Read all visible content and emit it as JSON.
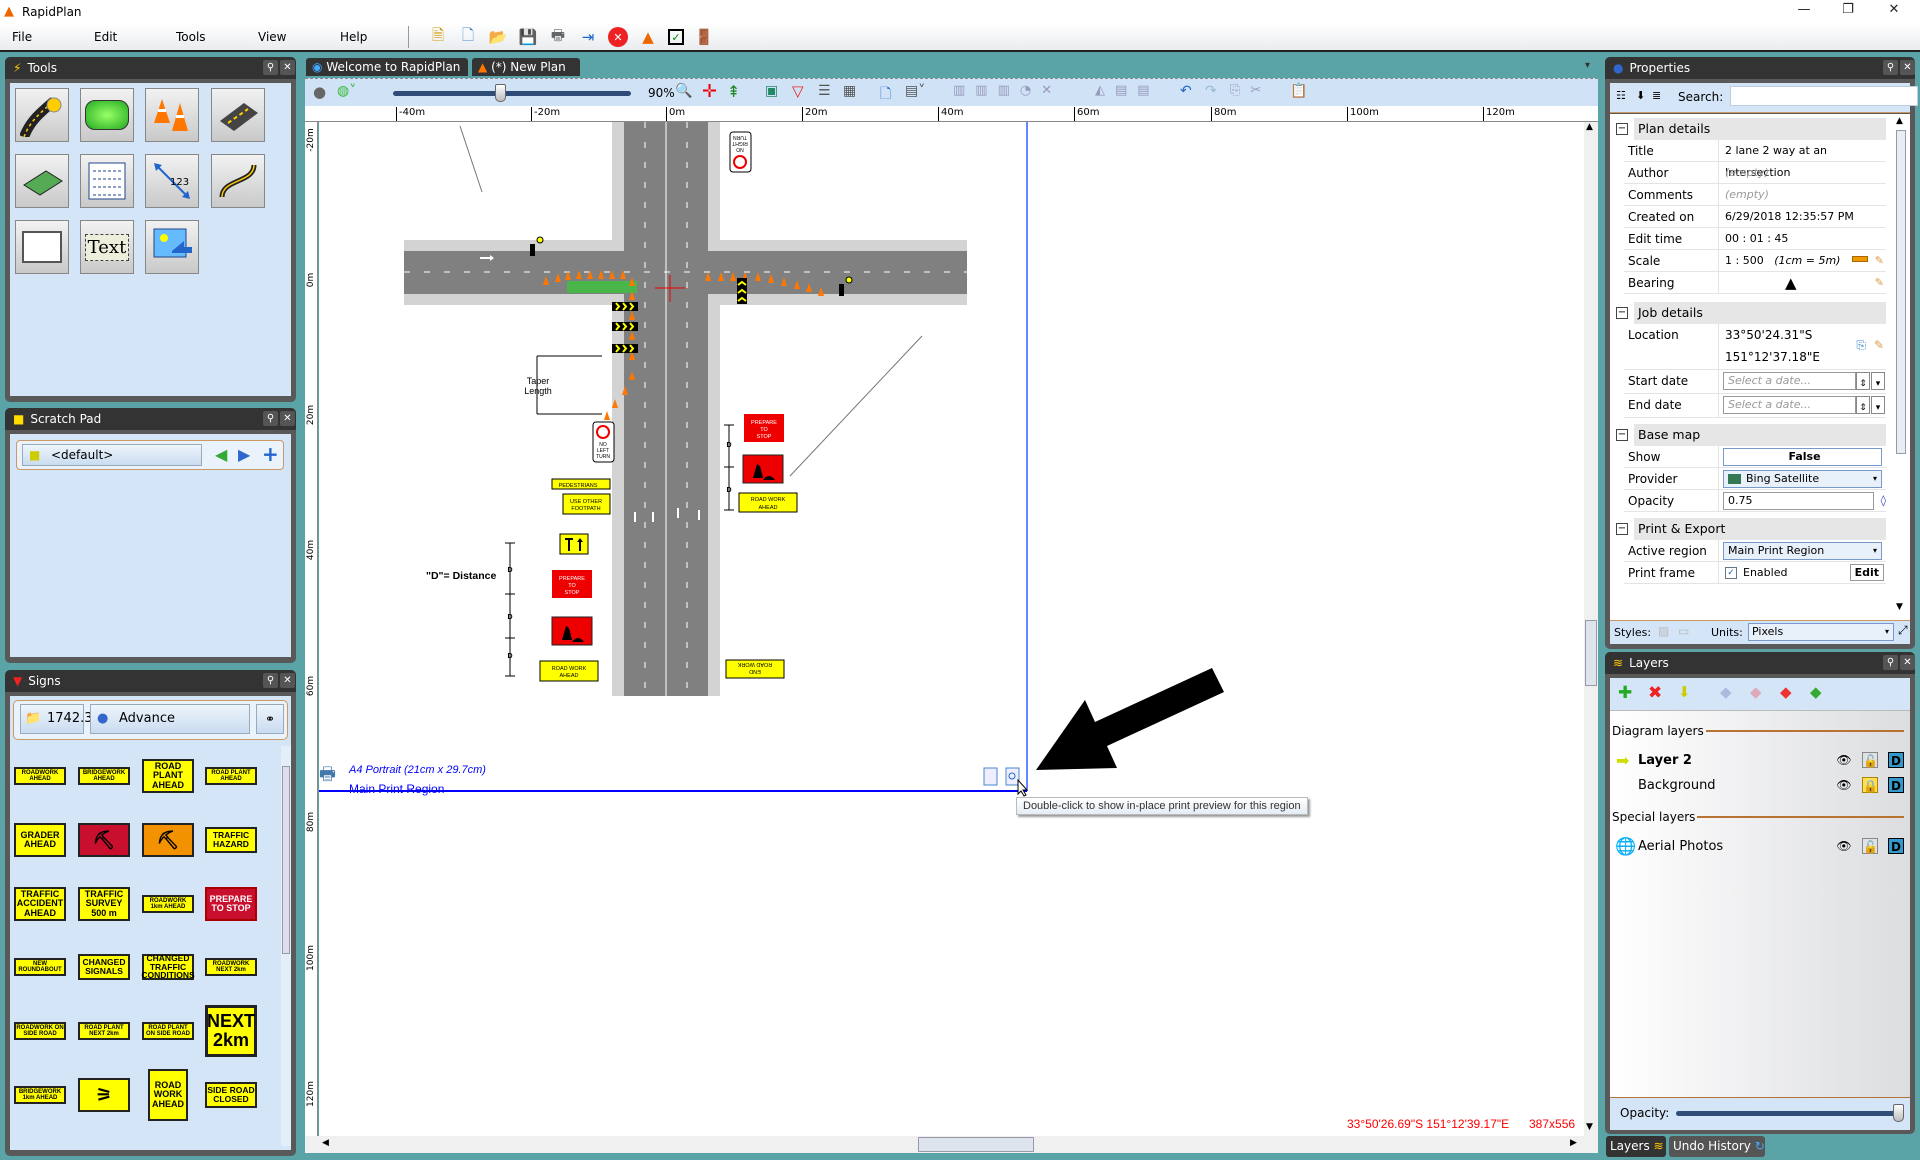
{
  "app": {
    "title": "RapidPlan",
    "menu": [
      "File",
      "Edit",
      "Tools",
      "View",
      "Help"
    ],
    "toolbar_icons": [
      "new-plan-wizard-icon",
      "new-document-icon",
      "open-folder-icon",
      "save-icon",
      "print-icon",
      "export-icon",
      "close-red-icon",
      "rapidplan-cone-icon",
      "checklist-icon",
      "exit-door-icon"
    ]
  },
  "tools_panel": {
    "title": "Tools",
    "tools": [
      "road-tool",
      "barrier-tool",
      "cones-tool",
      "road-segment-tool",
      "area-pattern-tool",
      "grid-tool",
      "measure-tool",
      "path-tool",
      "rectangle-tool",
      "text-tool",
      "image-tool"
    ],
    "text_tile": "Text",
    "measure_label": "123"
  },
  "scratch_pad": {
    "title": "Scratch Pad",
    "selected": "<default>"
  },
  "signs_panel": {
    "title": "Signs",
    "category_code": "1742.3",
    "category": "Advance",
    "signs": [
      {
        "text": "ROADWORK AHEAD",
        "bg": "#ffff00",
        "size": "small"
      },
      {
        "text": "BRIDGEWORK AHEAD",
        "bg": "#ffff00",
        "size": "small"
      },
      {
        "text": "ROAD PLANT AHEAD",
        "bg": "#ffff00",
        "size": "large"
      },
      {
        "text": "ROAD PLANT AHEAD",
        "bg": "#ffff00",
        "size": "small"
      },
      {
        "text": "GRADER AHEAD",
        "bg": "#ffff00",
        "size": "large"
      },
      {
        "text": "",
        "bg": "#c8102e",
        "size": "worker"
      },
      {
        "text": "",
        "bg": "#f39200",
        "size": "worker"
      },
      {
        "text": "TRAFFIC HAZARD",
        "bg": "#ffff00",
        "size": "medium"
      },
      {
        "text": "TRAFFIC ACCIDENT AHEAD",
        "bg": "#ffff00",
        "size": "large"
      },
      {
        "text": "TRAFFIC SURVEY 500 m",
        "bg": "#ffff00",
        "size": "large"
      },
      {
        "text": "ROADWORK 1km AHEAD",
        "bg": "#ffff00",
        "size": "small"
      },
      {
        "text": "PREPARE TO STOP",
        "bg": "#c8102e",
        "size": "red"
      },
      {
        "text": "NEW ROUNDABOUT",
        "bg": "#ffff00",
        "size": "small"
      },
      {
        "text": "CHANGED SIGNALS",
        "bg": "#ffff00",
        "size": "medium"
      },
      {
        "text": "CHANGED TRAFFIC CONDITIONS",
        "bg": "#ffff00",
        "size": "medium"
      },
      {
        "text": "ROADWORK NEXT 2km",
        "bg": "#ffff00",
        "size": "small"
      },
      {
        "text": "ROADWORK ON SIDE ROAD",
        "bg": "#ffff00",
        "size": "small"
      },
      {
        "text": "ROAD PLANT NEXT 2km",
        "bg": "#ffff00",
        "size": "small"
      },
      {
        "text": "ROAD PLANT ON SIDE ROAD",
        "bg": "#ffff00",
        "size": "small"
      },
      {
        "text": "NEXT 2km",
        "bg": "#ffff00",
        "size": "xl"
      },
      {
        "text": "BRIDGEWORK 1km AHEAD",
        "bg": "#ffff00",
        "size": "small"
      },
      {
        "text": "",
        "bg": "#ffff00",
        "size": "signal"
      },
      {
        "text": "ROAD WORK AHEAD",
        "bg": "#ffff00",
        "size": "tall"
      },
      {
        "text": "SIDE ROAD CLOSED",
        "bg": "#ffff00",
        "size": "medium"
      }
    ]
  },
  "document": {
    "tabs": [
      {
        "label": "Welcome to RapidPlan",
        "icon": "rapidplan-globe-icon"
      },
      {
        "label": "(*) New Plan",
        "icon": "cone-icon"
      }
    ],
    "zoom": "90%",
    "zoom_fraction": 0.45,
    "ruler_x": [
      "-40m",
      "-20m",
      "0m",
      "20m",
      "40m",
      "60m",
      "80m",
      "100m",
      "120m"
    ],
    "ruler_y": [
      "-20m",
      "0m",
      "20m",
      "40m",
      "60m",
      "80m",
      "100m",
      "120m"
    ],
    "print_region": {
      "paper": "A4 Portrait (21cm x 29.7cm)",
      "name": "Main Print Region"
    },
    "tooltip": "Double-click to show in-place print preview for this region",
    "status_coords": "33°50'26.69\"S 151°12'39.17\"E",
    "status_size": "387x556",
    "drawing": {
      "taper": "Taper",
      "length": "Length",
      "distance_label": "\"D\"= Distance",
      "d": "D",
      "no_left_turn": [
        "NO",
        "LEFT",
        "TURN"
      ],
      "no_right_turn": [
        "NO",
        "RIGHT",
        "TURN"
      ],
      "prepare": [
        "PREPARE",
        "TO",
        "STOP"
      ],
      "road_work_ahead": [
        "ROAD WORK",
        "AHEAD"
      ],
      "end_road_work": [
        "END",
        "ROAD WORK"
      ],
      "pedestrians": "PEDESTRIANS",
      "use_other": [
        "USE OTHER",
        "FOOTPATH"
      ]
    }
  },
  "properties": {
    "title": "Properties",
    "search_label": "Search:",
    "search_value": "",
    "sections": {
      "plan": "Plan details",
      "job": "Job details",
      "base": "Base map",
      "print": "Print & Export"
    },
    "title_label": "Title",
    "title_value": "2 lane 2 way at an Intersection",
    "author_label": "Author",
    "author_value": "(empty)",
    "comments_label": "Comments",
    "comments_value": "(empty)",
    "created_label": "Created on",
    "created_value": "6/29/2018 12:35:57 PM",
    "edit_label": "Edit time",
    "edit_value": "00 : 01 : 45",
    "scale_label": "Scale",
    "scale_value": "1 : 500",
    "scale_note": "(1cm = 5m)",
    "bearing_label": "Bearing",
    "location_label": "Location",
    "location_lat": "33°50'24.31\"S",
    "location_lon": "151°12'37.18\"E",
    "start_label": "Start date",
    "end_label": "End date",
    "date_placeholder": "Select a date...",
    "show_label": "Show",
    "show_value": "False",
    "provider_label": "Provider",
    "provider_value": "Bing Satellite",
    "opacity_label": "Opacity",
    "opacity_value": "0.75",
    "active_label": "Active region",
    "active_value": "Main Print Region",
    "frame_label": "Print frame",
    "frame_value": "Enabled",
    "frame_checked": true,
    "frame_edit": "Edit",
    "styles_label": "Styles:",
    "units_label": "Units:",
    "units_value": "Pixels"
  },
  "layers": {
    "title": "Layers",
    "diagram_label": "Diagram layers",
    "special_label": "Special layers",
    "items": [
      {
        "name": "Layer 2",
        "active": true,
        "locked": false
      },
      {
        "name": "Background",
        "active": false,
        "locked": true
      }
    ],
    "special": [
      {
        "name": "Aerial Photos",
        "locked": false
      }
    ],
    "opacity_label": "Opacity:",
    "opacity_fraction": 1.0,
    "bottom_tabs": [
      "Layers",
      "Undo History"
    ]
  },
  "colors": {
    "panel_bg": "#d3e5f7",
    "header": "#333333",
    "accent_orange": "#b87333",
    "region_blue": "#0000ff",
    "status_red": "#ff0000"
  }
}
